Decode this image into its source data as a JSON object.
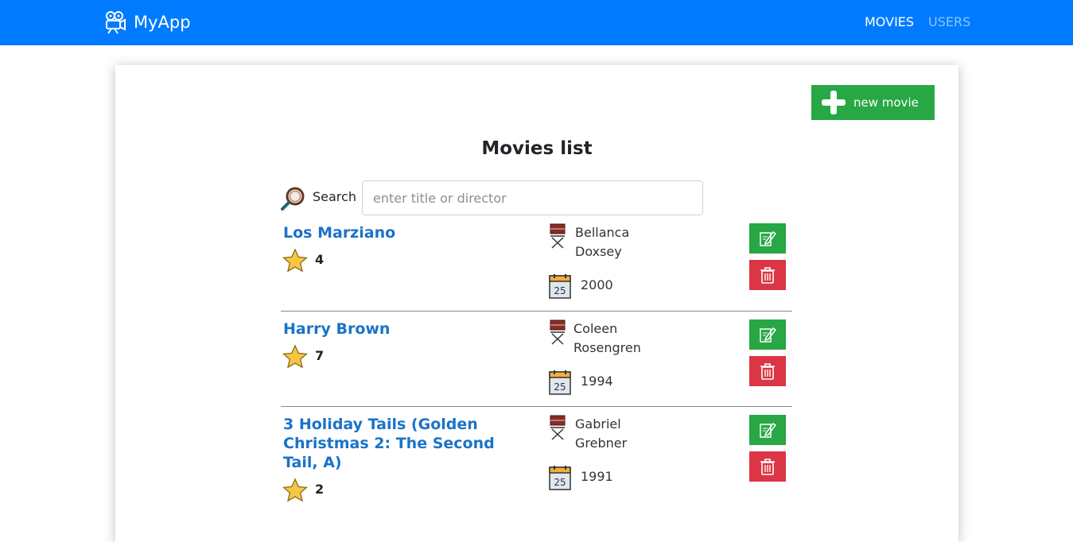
{
  "navbar": {
    "brand": "MyApp",
    "links": [
      "MOVIES",
      "USERS"
    ]
  },
  "toolbar": {
    "new_label": "new movie"
  },
  "page": {
    "title": "Movies list"
  },
  "search": {
    "label": "Search",
    "placeholder": "enter title or director",
    "value": ""
  },
  "movies": [
    {
      "title": "Los Marziano",
      "rating": "4",
      "director": "Bellanca Doxsey",
      "year": "2000"
    },
    {
      "title": "Harry Brown",
      "rating": "7",
      "director": "Coleen Rosengren",
      "year": "1994"
    },
    {
      "title": "3 Holiday Tails (Golden Christmas 2: The Second Tail, A)",
      "rating": "2",
      "director": "Gabriel Grebner",
      "year": "1991"
    }
  ],
  "colors": {
    "navbar": "#007bff",
    "add": "#28a745",
    "edit": "#28a745",
    "delete": "#dc3545",
    "title_link": "#1a73c9"
  },
  "icons": {
    "brand": "movie-camera-icon",
    "add": "plus-icon",
    "search": "magnifier-icon",
    "rating": "star-icon",
    "director": "director-chair-icon",
    "year": "calendar-icon",
    "edit": "edit-icon",
    "delete": "trash-icon"
  }
}
